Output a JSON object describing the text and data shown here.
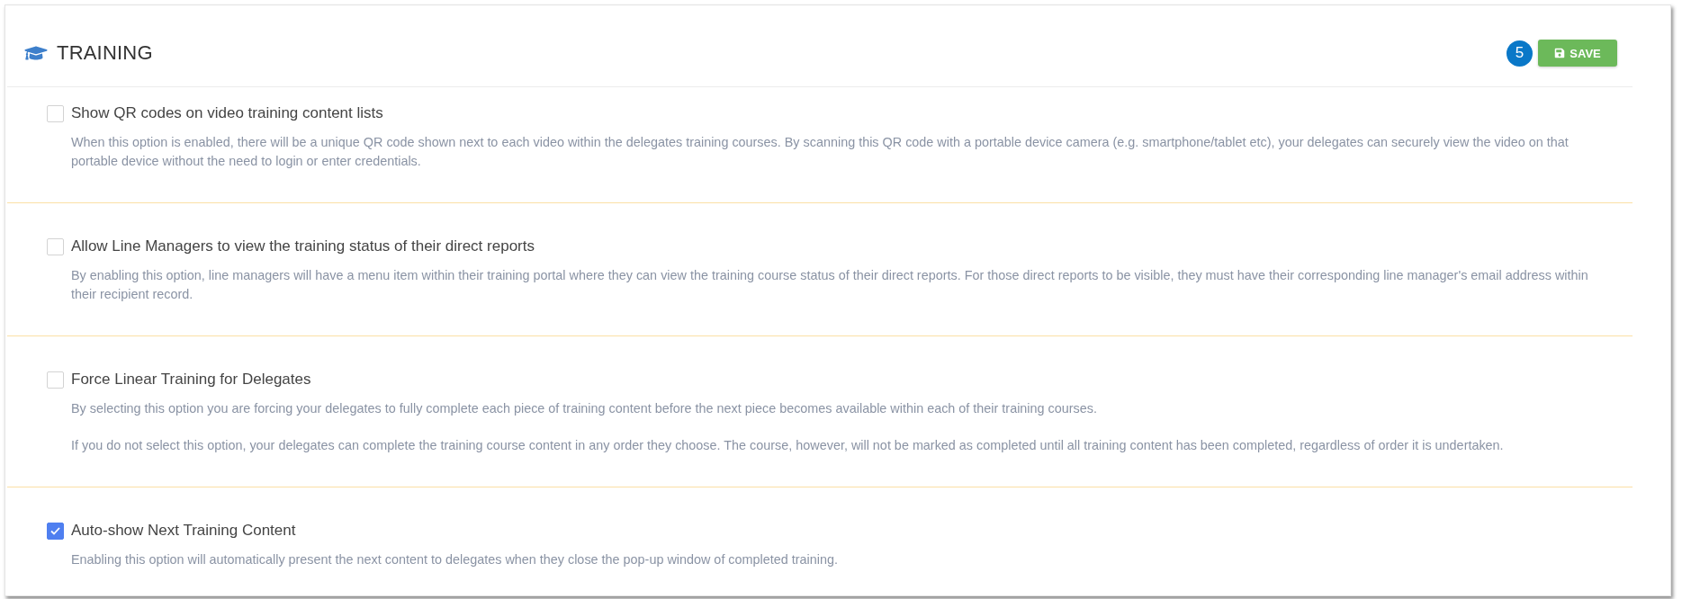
{
  "header": {
    "title": "TRAINING",
    "badge": "5",
    "save_button": "SAVE"
  },
  "options": [
    {
      "label": "Show QR codes on video training content lists",
      "checked": false,
      "paragraphs": [
        "When this option is enabled, there will be a unique QR code shown next to each video within the delegates training courses. By scanning this QR code with a portable device camera (e.g. smartphone/tablet etc), your delegates can securely view the video on that portable device without the need to login or enter credentials."
      ]
    },
    {
      "label": "Allow Line Managers to view the training status of their direct reports",
      "checked": false,
      "paragraphs": [
        "By enabling this option, line managers will have a menu item within their training portal where they can view the training course status of their direct reports. For those direct reports to be visible, they must have their corresponding line manager's email address within their recipient record."
      ]
    },
    {
      "label": "Force Linear Training for Delegates",
      "checked": false,
      "paragraphs": [
        "By selecting this option you are forcing your delegates to fully complete each piece of training content before the next piece becomes available within each of their training courses.",
        "If you do not select this option, your delegates can complete the training course content in any order they choose. The course, however, will not be marked as completed until all training content has been completed, regardless of order it is undertaken."
      ]
    },
    {
      "label": "Auto-show Next Training Content",
      "checked": true,
      "paragraphs": [
        "Enabling this option will automatically present the next content to delegates when they close the pop-up window of completed training."
      ]
    }
  ]
}
